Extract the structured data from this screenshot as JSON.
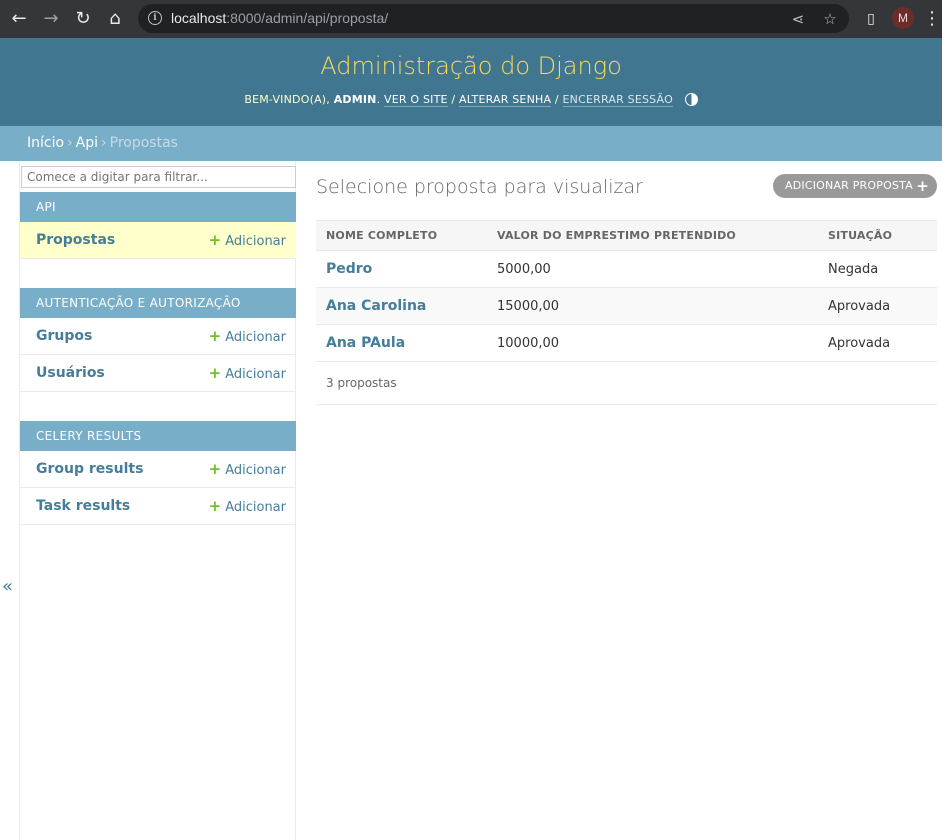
{
  "browser": {
    "url_host": "localhost",
    "url_rest": ":8000/admin/api/proposta/",
    "avatar_letter": "M"
  },
  "header": {
    "title": "Administração do Django",
    "welcome": "BEM-VINDO(A),",
    "username": "ADMIN",
    "view_site": "VER O SITE",
    "change_password": "ALTERAR SENHA",
    "logout": "ENCERRAR SESSÃO"
  },
  "breadcrumbs": {
    "home": "Início",
    "app": "Api",
    "current": "Propostas",
    "separator": "›"
  },
  "sidebar": {
    "filter_placeholder": "Comece a digitar para filtrar...",
    "add_label": "Adicionar",
    "modules": [
      {
        "caption": "API",
        "models": [
          {
            "name": "Propostas"
          }
        ]
      },
      {
        "caption": "AUTENTICAÇÃO E AUTORIZAÇÃO",
        "models": [
          {
            "name": "Grupos"
          },
          {
            "name": "Usuários"
          }
        ]
      },
      {
        "caption": "CELERY RESULTS",
        "models": [
          {
            "name": "Group results"
          },
          {
            "name": "Task results"
          }
        ]
      }
    ],
    "collapse_label": "«"
  },
  "main": {
    "title": "Selecione proposta para visualizar",
    "add_button": "ADICIONAR PROPOSTA",
    "columns": [
      "NOME COMPLETO",
      "VALOR DO EMPRESTIMO PRETENDIDO",
      "SITUAÇÃO"
    ],
    "rows": [
      {
        "name": "Pedro",
        "value": "5000,00",
        "status": "Negada"
      },
      {
        "name": "Ana Carolina",
        "value": "15000,00",
        "status": "Aprovada"
      },
      {
        "name": "Ana PAula",
        "value": "10000,00",
        "status": "Aprovada"
      }
    ],
    "count": "3 propostas"
  },
  "colors": {
    "header_bg": "#417690",
    "title_yellow": "#f5dd5d",
    "breadcrumb_bg": "#79aec8",
    "link": "#447e9b",
    "add_green": "#70bf2b",
    "selected_row": "#ffffcc"
  }
}
